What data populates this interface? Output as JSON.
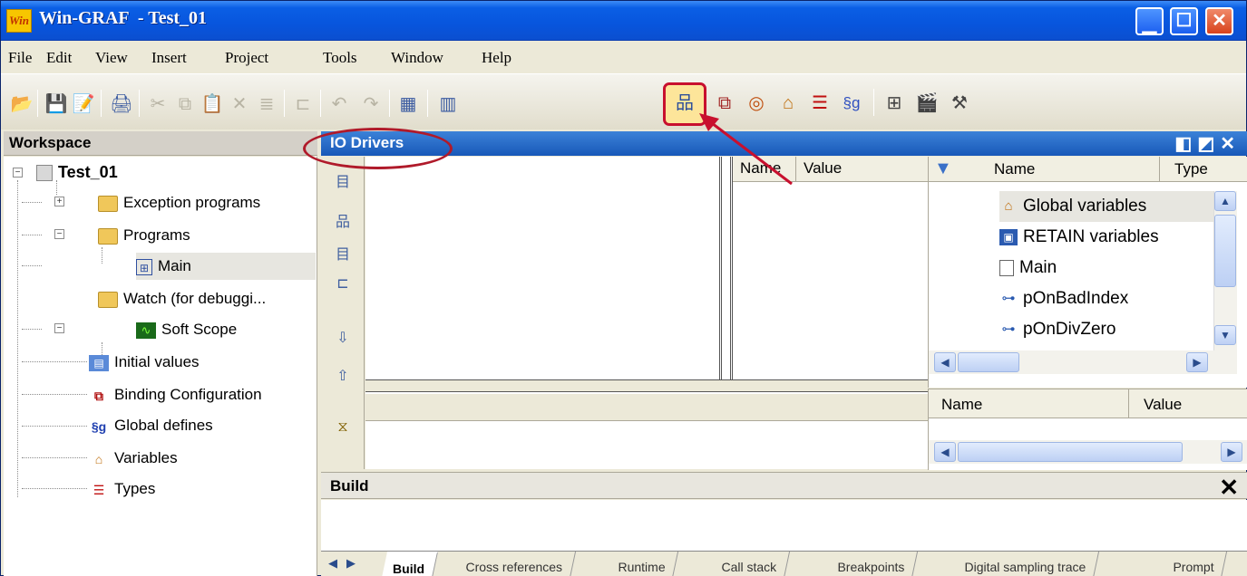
{
  "window": {
    "app_name": "Win-GRAF",
    "title": "Win-GRAF  - Test_01",
    "logo_text": "Win"
  },
  "menu": [
    "File",
    "Edit",
    "View",
    "Insert",
    "Project",
    "Tools",
    "Window",
    "Help"
  ],
  "workspace": {
    "header": "Workspace",
    "project": "Test_01",
    "items": [
      {
        "label": "Exception programs"
      },
      {
        "label": "Programs"
      },
      {
        "label": "Main"
      },
      {
        "label": "Watch (for debuggi..."
      },
      {
        "label": "Soft Scope"
      },
      {
        "label": "Initial values"
      },
      {
        "label": "Binding Configuration"
      },
      {
        "label": "Global defines"
      },
      {
        "label": "Variables"
      },
      {
        "label": "Types"
      }
    ],
    "selected": "Main"
  },
  "io_drivers": {
    "title": "IO Drivers",
    "grid_headers": {
      "name": "Name",
      "value": "Value"
    }
  },
  "variables_panel": {
    "headers": {
      "name": "Name",
      "type": "Type"
    },
    "rows": [
      {
        "label": "Global variables",
        "icon": "house-icon",
        "selected": true
      },
      {
        "label": "RETAIN variables",
        "icon": "save-icon"
      },
      {
        "label": "Main",
        "icon": "page-icon"
      },
      {
        "label": "pOnBadIndex",
        "icon": "tree-icon"
      },
      {
        "label": "pOnDivZero",
        "icon": "tree-icon"
      }
    ],
    "lower_headers": {
      "name": "Name",
      "value": "Value"
    }
  },
  "build": {
    "title": "Build",
    "tabs": [
      "Build",
      "Cross references",
      "Runtime",
      "Call stack",
      "Breakpoints",
      "Digital sampling trace",
      "Prompt"
    ],
    "active_tab": "Build"
  },
  "colors": {
    "annotation": "#c8102e",
    "titlebar": "#0855dd",
    "io_header": "#1858b8"
  }
}
